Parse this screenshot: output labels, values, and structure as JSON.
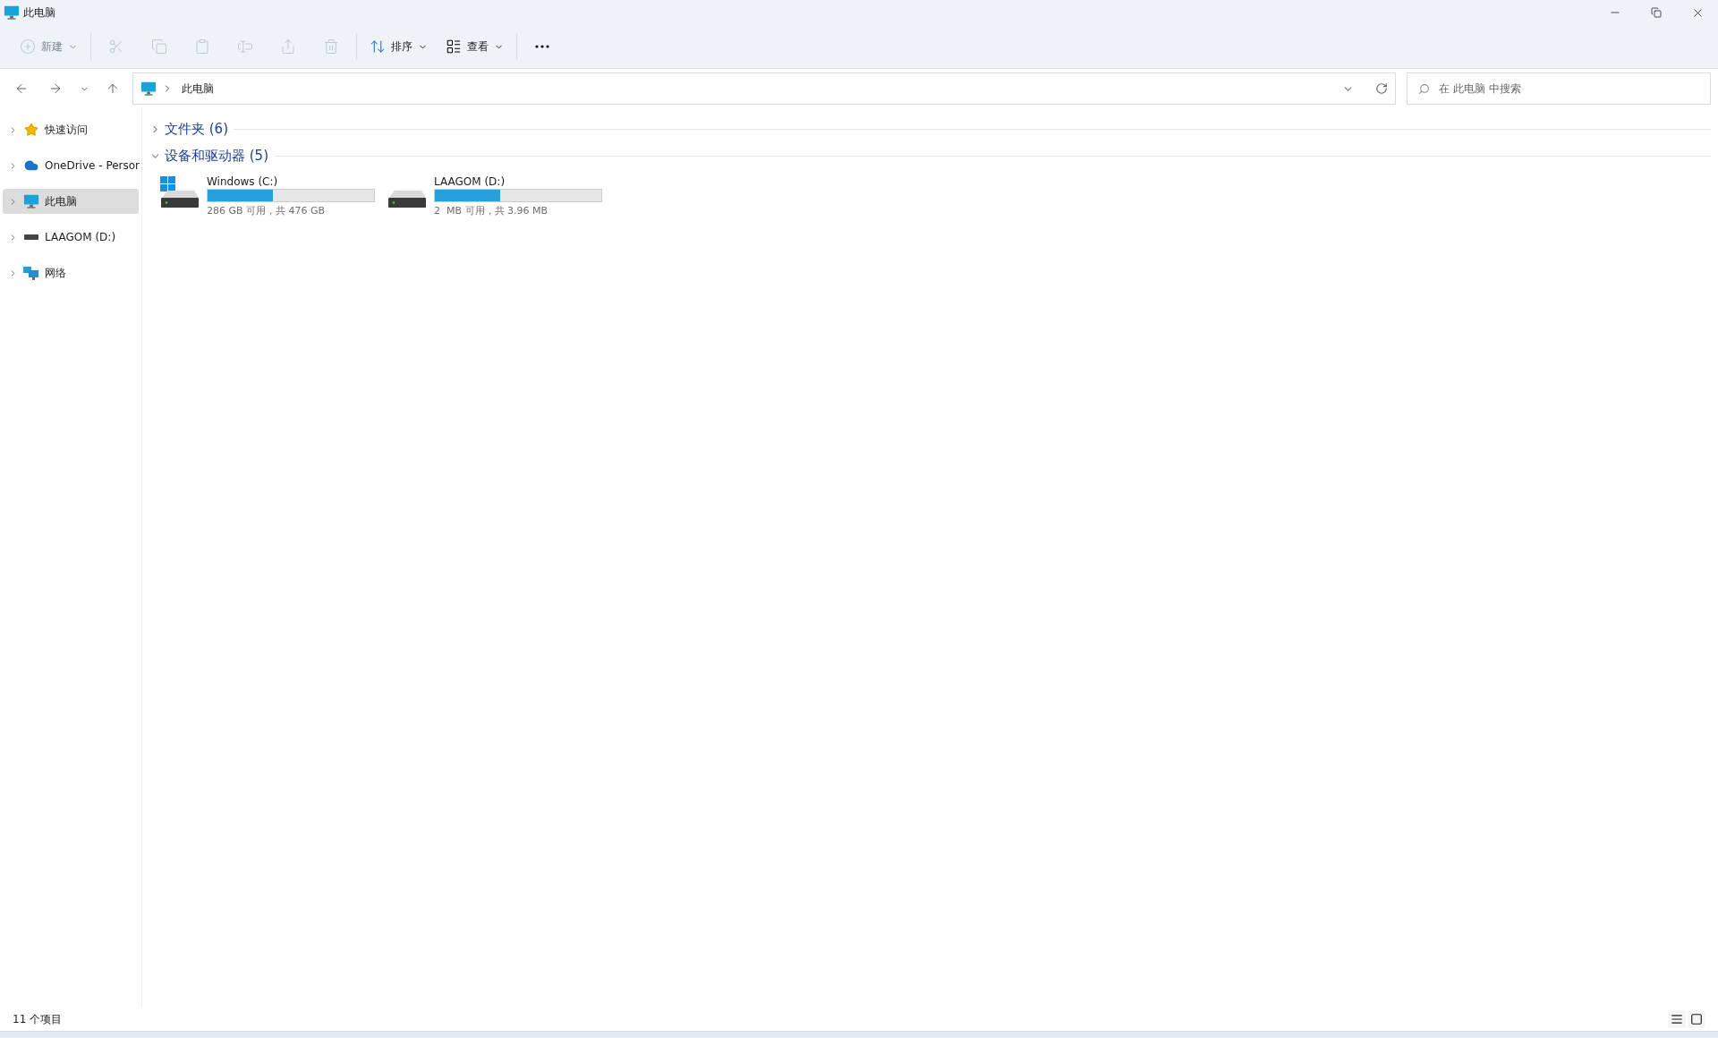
{
  "window": {
    "title": "此电脑"
  },
  "toolbar": [
    {
      "kind": "new",
      "label": "新建",
      "disabled": true
    },
    {
      "kind": "cut",
      "disabled": true
    },
    {
      "kind": "copy",
      "disabled": true
    },
    {
      "kind": "paste",
      "disabled": true
    },
    {
      "kind": "rename",
      "disabled": true
    },
    {
      "kind": "share",
      "disabled": true
    },
    {
      "kind": "delete",
      "disabled": true
    },
    {
      "kind": "sort",
      "label": "排序",
      "disabled": false
    },
    {
      "kind": "view",
      "label": "查看",
      "disabled": false
    },
    {
      "kind": "more",
      "disabled": false
    }
  ],
  "address_bar": {
    "path": "此电脑"
  },
  "search": {
    "placeholder": "在 此电脑 中搜索"
  },
  "sidebar": {
    "items": [
      {
        "kind": "star",
        "label": "快速访问",
        "selected": false
      },
      {
        "kind": "cloud",
        "label": "OneDrive - Persor",
        "selected": false
      },
      {
        "kind": "pc",
        "label": "此电脑",
        "selected": true
      },
      {
        "kind": "drive",
        "label": "LAAGOM (D:)",
        "selected": false
      },
      {
        "kind": "network",
        "label": "网络",
        "selected": false
      }
    ]
  },
  "sections": [
    {
      "title": "文件夹 (6)",
      "expanded": false
    },
    {
      "title": "设备和驱动器 (5)",
      "expanded": true
    }
  ],
  "drives": [
    {
      "kind": "windows",
      "name": "Windows (C:)",
      "level": 0.39,
      "reading": "286 GB 可用，共 476 GB"
    },
    {
      "kind": "plain",
      "name": "LAAGOM (D:)",
      "level": 0.39,
      "reading": "2  MB 可用，共 3.96 MB"
    }
  ],
  "status_bar": {
    "count": "11 个项目",
    "views": [
      {
        "kind": "details",
        "selected": false
      },
      {
        "kind": "tiles",
        "selected": false
      }
    ]
  }
}
